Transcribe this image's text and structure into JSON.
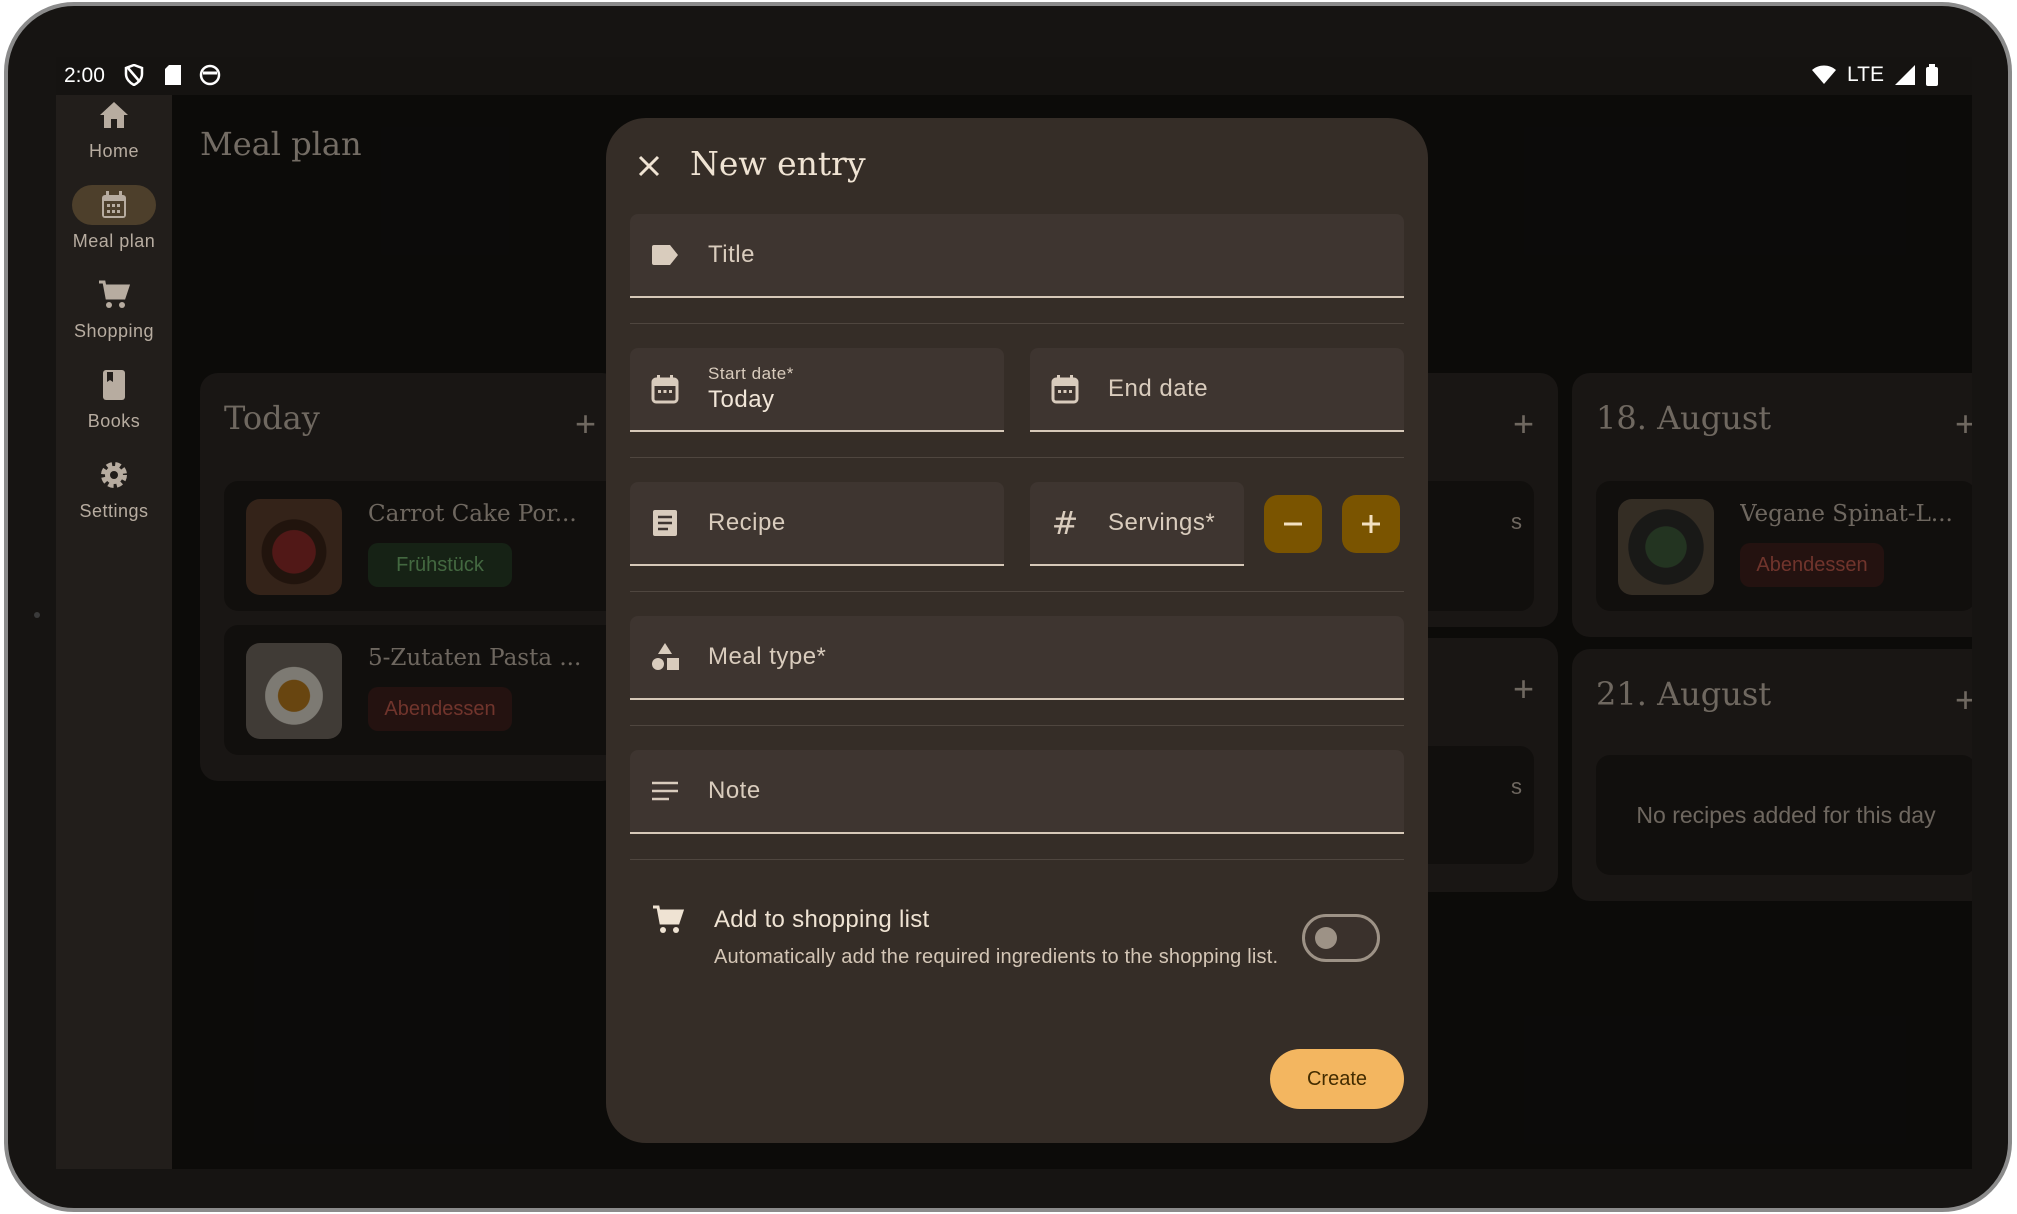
{
  "status_bar": {
    "time": "2:00",
    "network": "LTE"
  },
  "nav": {
    "items": [
      {
        "label": "Home",
        "icon": "home-icon"
      },
      {
        "label": "Meal plan",
        "icon": "calendar-icon",
        "active": true
      },
      {
        "label": "Shopping",
        "icon": "cart-icon"
      },
      {
        "label": "Books",
        "icon": "book-icon"
      },
      {
        "label": "Settings",
        "icon": "gear-icon"
      }
    ]
  },
  "page": {
    "title": "Meal plan"
  },
  "days": {
    "today": {
      "title": "Today",
      "entries": [
        {
          "name": "Carrot Cake Por...",
          "tag": "Frühstück"
        },
        {
          "name": "5-Zutaten Pasta ...",
          "tag": "Abendessen"
        }
      ]
    },
    "aug18": {
      "title": "18. August",
      "entries": [
        {
          "name": "Vegane Spinat-L...",
          "tag": "Abendessen"
        }
      ]
    },
    "aug21": {
      "title": "21. August",
      "empty_text": "No recipes added for this day"
    },
    "partial_text_1": "s",
    "partial_text_2": "s"
  },
  "dialog": {
    "title": "New entry",
    "fields": {
      "title_label": "Title",
      "start_date_label": "Start date*",
      "start_date_value": "Today",
      "end_date_label": "End date",
      "recipe_label": "Recipe",
      "servings_label": "Servings*",
      "meal_type_label": "Meal type*",
      "note_label": "Note"
    },
    "shopping": {
      "title": "Add to shopping list",
      "description": "Automatically add the required ingredients to the shopping list.",
      "enabled": false
    },
    "create_label": "Create"
  },
  "colors": {
    "accent": "#f3b660",
    "stepper": "#7a5400",
    "dialog_bg": "#352d27",
    "chip_green": "#74b36f",
    "chip_red": "#c15b4c"
  }
}
